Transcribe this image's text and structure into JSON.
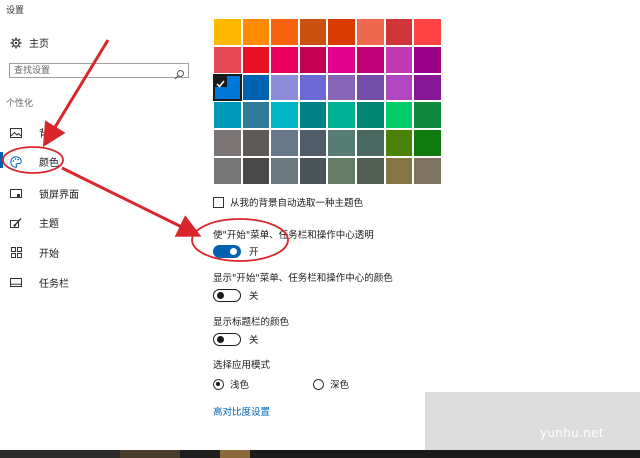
{
  "window": {
    "title": "设置"
  },
  "sidebar": {
    "home_label": "主页",
    "search_placeholder": "查找设置",
    "section_label": "个性化",
    "items": [
      {
        "label": "背景",
        "icon": "image-icon"
      },
      {
        "label": "颜色",
        "icon": "palette-icon",
        "active": true
      },
      {
        "label": "锁屏界面",
        "icon": "lock-screen-icon"
      },
      {
        "label": "主题",
        "icon": "theme-icon"
      },
      {
        "label": "开始",
        "icon": "start-grid-icon"
      },
      {
        "label": "任务栏",
        "icon": "taskbar-icon"
      }
    ]
  },
  "colors": {
    "accent": "#0063b1",
    "selected_index": 16,
    "swatches": [
      "#ffb900",
      "#ff8c00",
      "#f7630c",
      "#ca5010",
      "#da3b01",
      "#ef6950",
      "#d13438",
      "#ff4343",
      "#e74856",
      "#e81123",
      "#ea005e",
      "#c30052",
      "#e3008c",
      "#bf0077",
      "#c239b3",
      "#9a0089",
      "#0078d7",
      "#0063b1",
      "#8e8cd8",
      "#6b69d6",
      "#8764b8",
      "#744da9",
      "#b146c2",
      "#881798",
      "#0099bc",
      "#2d7d9a",
      "#00b7c3",
      "#038387",
      "#00b294",
      "#018574",
      "#00cc6a",
      "#10893e",
      "#7a7574",
      "#5d5a58",
      "#68768a",
      "#515c6b",
      "#567c73",
      "#486860",
      "#498205",
      "#107c10",
      "#767676",
      "#4c4a48",
      "#69797e",
      "#4a5459",
      "#647c64",
      "#525e54",
      "#847545",
      "#7e735f"
    ]
  },
  "settings": {
    "auto_pick_label": "从我的背景自动选取一种主题色",
    "transparency": {
      "label": "使\"开始\"菜单、任务栏和操作中心透明",
      "state": "开",
      "on": true
    },
    "show_color_start": {
      "label": "显示\"开始\"菜单、任务栏和操作中心的颜色",
      "state": "关",
      "on": false
    },
    "show_color_titlebar": {
      "label": "显示标题栏的颜色",
      "state": "关",
      "on": false
    },
    "app_mode": {
      "label": "选择应用模式",
      "options": [
        "浅色",
        "深色"
      ],
      "selected": "浅色"
    },
    "high_contrast_link": "高对比度设置"
  },
  "watermark": "yunhu.net",
  "annotation_color": "#d9262c"
}
